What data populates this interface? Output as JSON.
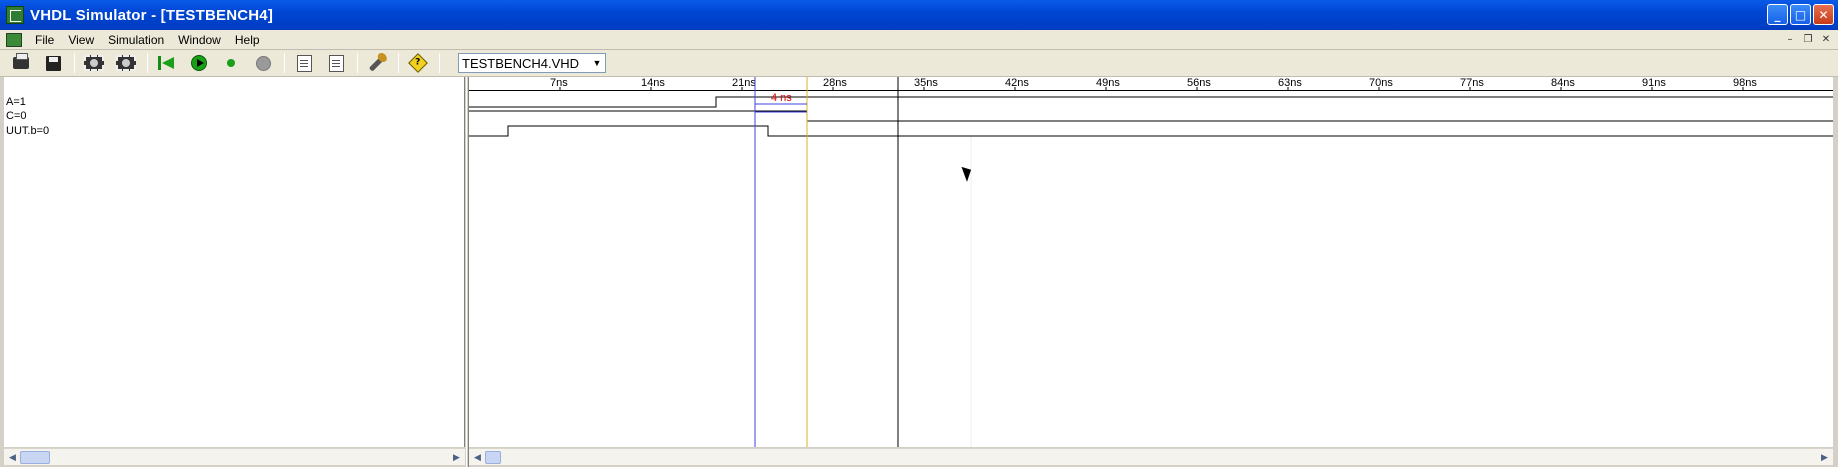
{
  "window": {
    "title": "VHDL Simulator - [TESTBENCH4]"
  },
  "menu": {
    "items": [
      "File",
      "View",
      "Simulation",
      "Window",
      "Help"
    ]
  },
  "toolbar": {
    "icons": [
      "printer-icon",
      "save-icon",
      "zoom-in-icon",
      "zoom-out-icon",
      "restart-icon",
      "run-icon",
      "step-icon",
      "stop-icon",
      "add-signal-icon",
      "remove-signal-icon",
      "settings-icon",
      "help-icon"
    ],
    "selected_file": "TESTBENCH4.VHD"
  },
  "signals": [
    {
      "name": "A=1"
    },
    {
      "name": "C=0"
    },
    {
      "name": "UUT.b=0"
    }
  ],
  "timeline": {
    "ticks": [
      "7ns",
      "14ns",
      "21ns",
      "28ns",
      "35ns",
      "42ns",
      "49ns",
      "56ns",
      "63ns",
      "70ns",
      "77ns",
      "84ns",
      "91ns",
      "98ns"
    ],
    "tick_values": [
      7,
      14,
      21,
      28,
      35,
      42,
      49,
      56,
      63,
      70,
      77,
      84,
      91,
      98
    ],
    "delta_label": "4 ns",
    "cursors": {
      "blue": 22,
      "yellow": 26,
      "black": 33
    },
    "colors": {
      "blue_cursor": "#4040e0",
      "yellow_cursor": "#d8b020",
      "black_cursor": "#000000",
      "delta": "#e00000"
    }
  },
  "waveforms": {
    "A": [
      [
        0,
        0
      ],
      [
        19,
        1
      ]
    ],
    "C": [
      [
        0,
        1
      ],
      [
        26,
        0
      ]
    ],
    "UUT.b": [
      [
        0,
        0
      ],
      [
        3,
        1
      ],
      [
        23,
        0
      ]
    ]
  }
}
